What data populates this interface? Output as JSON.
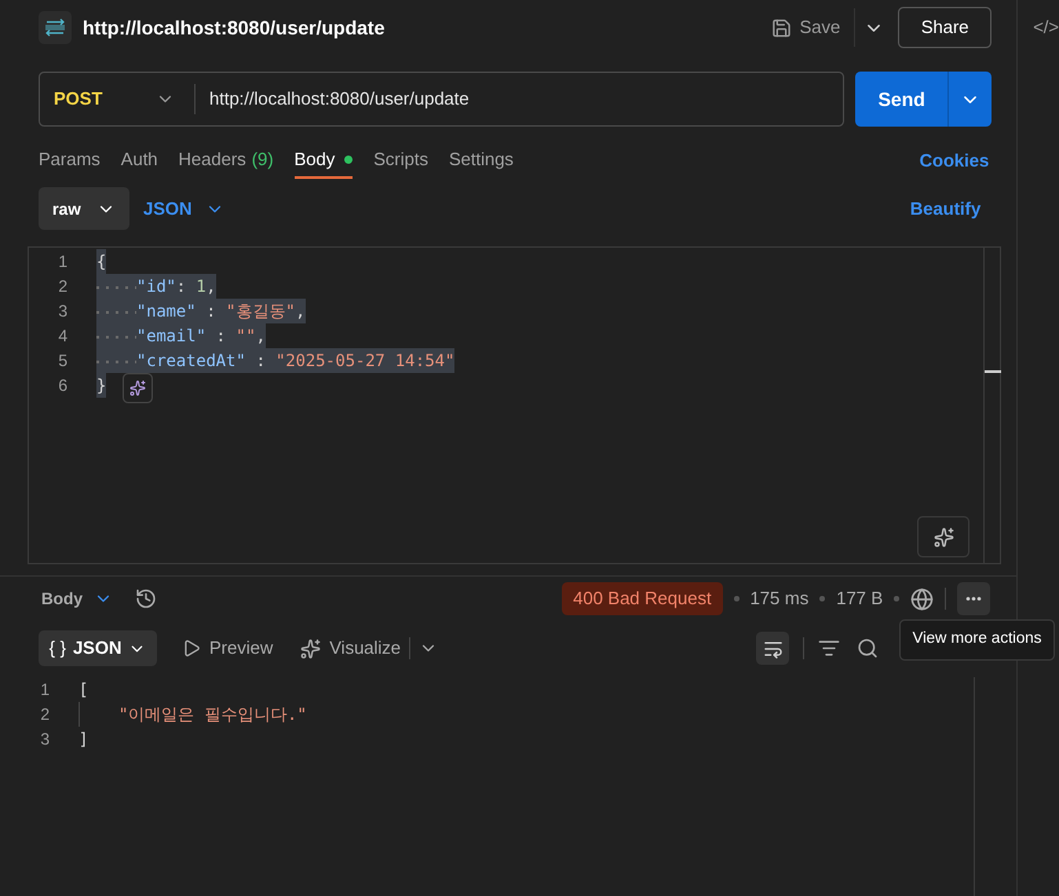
{
  "header": {
    "title": "http://localhost:8080/user/update",
    "save": "Save",
    "share": "Share",
    "side_label": "</>"
  },
  "request": {
    "method": "POST",
    "url": "http://localhost:8080/user/update",
    "send": "Send"
  },
  "tabs": [
    {
      "label": "Params",
      "selected": false
    },
    {
      "label": "Auth",
      "selected": false
    },
    {
      "label": "Headers",
      "count": "(9)",
      "selected": false
    },
    {
      "label": "Body",
      "dot": true,
      "selected": true
    },
    {
      "label": "Scripts",
      "selected": false
    },
    {
      "label": "Settings",
      "selected": false
    }
  ],
  "cookies": "Cookies",
  "body_mode": {
    "type": "raw",
    "format": "JSON",
    "beautify": "Beautify"
  },
  "editor": {
    "lines": [
      {
        "number": "1",
        "selected": true,
        "tokens": [
          {
            "kind": "punct",
            "text": "{"
          }
        ]
      },
      {
        "number": "2",
        "selected": true,
        "indented": true,
        "tokens": [
          {
            "kind": "key",
            "text": "\"id\""
          },
          {
            "kind": "punct",
            "text": ": "
          },
          {
            "kind": "number",
            "text": "1"
          },
          {
            "kind": "punct",
            "text": ","
          }
        ]
      },
      {
        "number": "3",
        "selected": true,
        "indented": true,
        "tokens": [
          {
            "kind": "key",
            "text": "\"name\""
          },
          {
            "kind": "punct",
            "text": " : "
          },
          {
            "kind": "string",
            "text": "\"홍길동\""
          },
          {
            "kind": "punct",
            "text": ","
          }
        ]
      },
      {
        "number": "4",
        "selected": true,
        "indented": true,
        "tokens": [
          {
            "kind": "key",
            "text": "\"email\""
          },
          {
            "kind": "punct",
            "text": " : "
          },
          {
            "kind": "string",
            "text": "\"\""
          },
          {
            "kind": "punct",
            "text": ","
          }
        ]
      },
      {
        "number": "5",
        "selected": true,
        "indented": true,
        "tokens": [
          {
            "kind": "key",
            "text": "\"createdAt\""
          },
          {
            "kind": "punct",
            "text": " : "
          },
          {
            "kind": "string",
            "text": "\"2025-05-27 14:54\""
          }
        ]
      },
      {
        "number": "6",
        "selected": true,
        "tokens": [
          {
            "kind": "punct",
            "text": "}"
          }
        ]
      }
    ]
  },
  "response": {
    "view": "Body",
    "status": "400 Bad Request",
    "time": "175 ms",
    "size": "177 B",
    "format": "JSON",
    "format_icon": "{ }",
    "preview": "Preview",
    "visualize": "Visualize",
    "tooltip": "View more actions",
    "lines": [
      {
        "number": "1",
        "tokens": [
          {
            "kind": "punct",
            "text": "["
          }
        ]
      },
      {
        "number": "2",
        "indented": true,
        "tokens": [
          {
            "kind": "string",
            "text": "\"이메일은 필수입니다.\""
          }
        ]
      },
      {
        "number": "3",
        "tokens": [
          {
            "kind": "punct",
            "text": "]"
          }
        ]
      }
    ]
  }
}
